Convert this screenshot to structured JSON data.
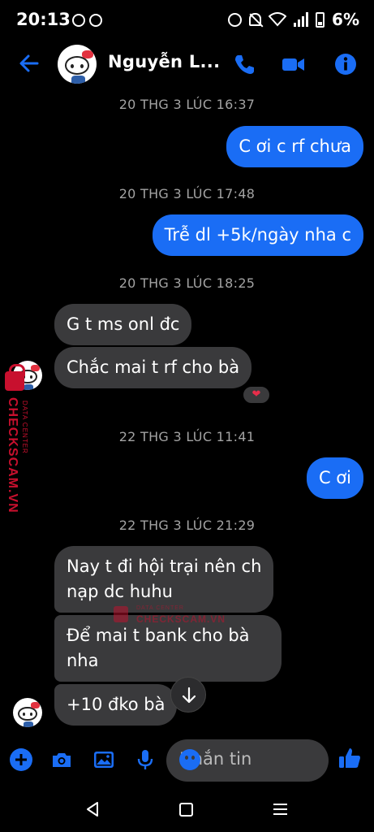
{
  "status_bar": {
    "time": "20:13",
    "battery": "6%"
  },
  "header": {
    "contact_name": "Nguyễn L..."
  },
  "messages": [
    {
      "type": "timestamp",
      "text": "20 THG 3 LÚC 16:37"
    },
    {
      "type": "outgoing",
      "text": "C ơi c rf chưa"
    },
    {
      "type": "timestamp",
      "text": "20 THG 3 LÚC 17:48"
    },
    {
      "type": "outgoing",
      "text": "Trễ dl +5k/ngày nha c"
    },
    {
      "type": "timestamp",
      "text": "20 THG 3 LÚC 18:25"
    },
    {
      "type": "incoming",
      "text": "G t ms onl đc"
    },
    {
      "type": "incoming",
      "text": "Chắc mai t rf cho bà",
      "reaction": "❤"
    },
    {
      "type": "timestamp",
      "text": "22 THG 3 LÚC 11:41"
    },
    {
      "type": "outgoing",
      "text": "C ơi"
    },
    {
      "type": "timestamp",
      "text": "22 THG 3 LÚC 21:29"
    },
    {
      "type": "incoming",
      "lines": [
        "Nay t đi hội trại nên ch",
        "nạp dc huhu"
      ]
    },
    {
      "type": "incoming",
      "lines": [
        "Để mai t bank cho bà",
        "nha"
      ]
    },
    {
      "type": "incoming",
      "text": "+10 đko bà"
    }
  ],
  "watermark": {
    "brand": "CHECKSCAM.VN",
    "sub": "DATA CENTER"
  },
  "composer": {
    "placeholder": "Nhắn tin"
  },
  "colors": {
    "accent": "#1a6df5",
    "incoming_bubble": "#3a3a3c",
    "timestamp": "#a3a3a3",
    "watermark": "#c8102e"
  }
}
